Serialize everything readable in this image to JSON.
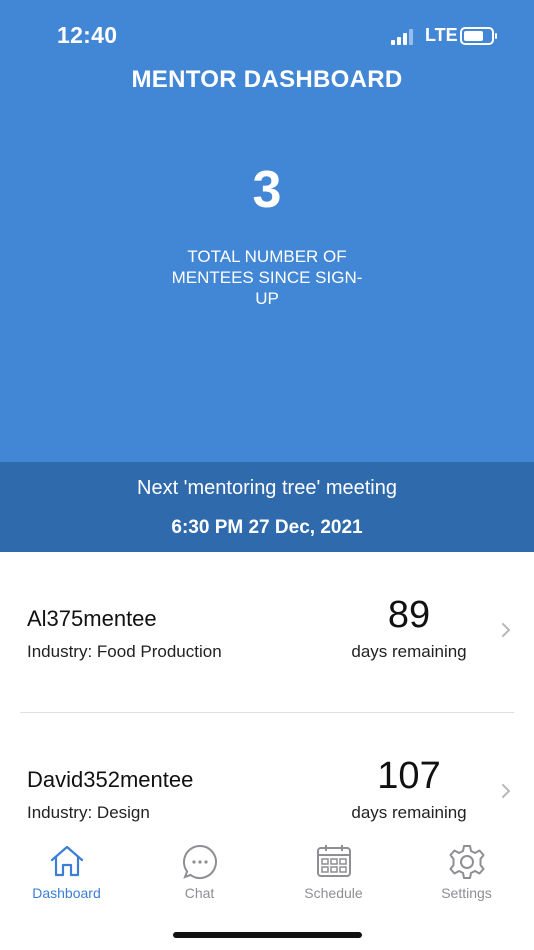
{
  "status_bar": {
    "time": "12:40",
    "network": "LTE"
  },
  "header": {
    "title": "MENTOR DASHBOARD"
  },
  "summary": {
    "count": "3",
    "label": "TOTAL NUMBER OF MENTEES SINCE SIGN-UP"
  },
  "meeting": {
    "title": "Next 'mentoring tree' meeting",
    "time": "6:30 PM 27 Dec, 2021"
  },
  "mentees": [
    {
      "name": "Al375mentee",
      "industry": "Industry: Food Production",
      "days": "89",
      "days_label": "days remaining"
    },
    {
      "name": "David352mentee",
      "industry": "Industry: Design",
      "days": "107",
      "days_label": "days remaining"
    }
  ],
  "tabs": [
    {
      "label": "Dashboard",
      "icon": "home-icon",
      "active": true
    },
    {
      "label": "Chat",
      "icon": "chat-icon",
      "active": false
    },
    {
      "label": "Schedule",
      "icon": "calendar-icon",
      "active": false
    },
    {
      "label": "Settings",
      "icon": "gear-icon",
      "active": false
    }
  ],
  "colors": {
    "primary": "#4286d6",
    "meeting_band": "#2f6aac",
    "tab_active": "#3b7fd4",
    "tab_inactive": "#8e8e93"
  }
}
